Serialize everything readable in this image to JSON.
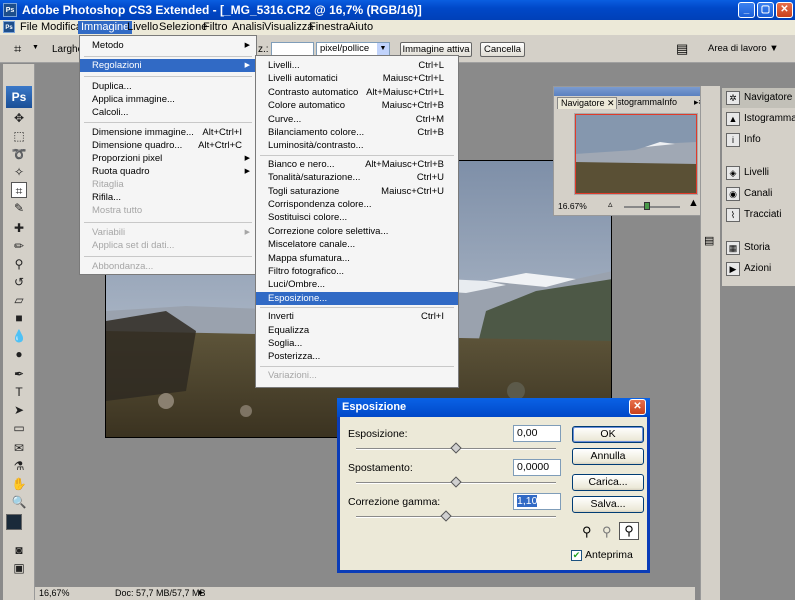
{
  "window": {
    "title": "Adobe Photoshop CS3 Extended - [_MG_5316.CR2 @ 16,7% (RGB/16)]",
    "app_icon": "Ps"
  },
  "menubar": [
    "File",
    "Modifica",
    "Immagine",
    "Livello",
    "Selezione",
    "Filtro",
    "Analisi",
    "Visualizza",
    "Finestra",
    "Aiuto"
  ],
  "options": {
    "larghezza": "Larghez",
    "resolution_suffix": "z.:",
    "unit": "pixel/pollice",
    "active_image_btn": "Immagine attiva",
    "cancel_btn": "Cancella",
    "workspace": "Area di lavoro"
  },
  "image_menu": {
    "items": [
      {
        "label": "Metodo",
        "shortcut": "",
        "submenu": true,
        "disabled": false
      },
      {
        "label": "Regolazioni",
        "shortcut": "",
        "submenu": true,
        "disabled": false,
        "highlighted": true
      },
      {
        "label": "Duplica...",
        "shortcut": "",
        "disabled": false
      },
      {
        "label": "Applica immagine...",
        "shortcut": "",
        "disabled": false
      },
      {
        "label": "Calcoli...",
        "shortcut": "",
        "disabled": false
      },
      {
        "label": "Dimensione immagine...",
        "shortcut": "Alt+Ctrl+I",
        "disabled": false
      },
      {
        "label": "Dimensione quadro...",
        "shortcut": "Alt+Ctrl+C",
        "disabled": false
      },
      {
        "label": "Proporzioni pixel",
        "shortcut": "",
        "submenu": true,
        "disabled": false
      },
      {
        "label": "Ruota quadro",
        "shortcut": "",
        "submenu": true,
        "disabled": false
      },
      {
        "label": "Ritaglia",
        "shortcut": "",
        "disabled": true
      },
      {
        "label": "Rifila...",
        "shortcut": "",
        "disabled": false
      },
      {
        "label": "Mostra tutto",
        "shortcut": "",
        "disabled": true
      },
      {
        "label": "Variabili",
        "shortcut": "",
        "submenu": true,
        "disabled": true
      },
      {
        "label": "Applica set di dati...",
        "shortcut": "",
        "disabled": true
      },
      {
        "label": "Abbondanza...",
        "shortcut": "",
        "disabled": true
      }
    ]
  },
  "adjust_menu": {
    "items": [
      {
        "label": "Livelli...",
        "shortcut": "Ctrl+L"
      },
      {
        "label": "Livelli automatici",
        "shortcut": "Maiusc+Ctrl+L"
      },
      {
        "label": "Contrasto automatico",
        "shortcut": "Alt+Maiusc+Ctrl+L"
      },
      {
        "label": "Colore automatico",
        "shortcut": "Maiusc+Ctrl+B"
      },
      {
        "label": "Curve...",
        "shortcut": "Ctrl+M"
      },
      {
        "label": "Bilanciamento colore...",
        "shortcut": "Ctrl+B"
      },
      {
        "label": "Luminosità/contrasto...",
        "shortcut": ""
      },
      {
        "label": "Bianco e nero...",
        "shortcut": "Alt+Maiusc+Ctrl+B"
      },
      {
        "label": "Tonalità/saturazione...",
        "shortcut": "Ctrl+U"
      },
      {
        "label": "Togli saturazione",
        "shortcut": "Maiusc+Ctrl+U"
      },
      {
        "label": "Corrispondenza colore...",
        "shortcut": ""
      },
      {
        "label": "Sostituisci colore...",
        "shortcut": ""
      },
      {
        "label": "Correzione colore selettiva...",
        "shortcut": ""
      },
      {
        "label": "Miscelatore canale...",
        "shortcut": ""
      },
      {
        "label": "Mappa sfumatura...",
        "shortcut": ""
      },
      {
        "label": "Filtro fotografico...",
        "shortcut": ""
      },
      {
        "label": "Luci/Ombre...",
        "shortcut": ""
      },
      {
        "label": "Esposizione...",
        "shortcut": "",
        "highlighted": true
      },
      {
        "label": "Inverti",
        "shortcut": "Ctrl+I"
      },
      {
        "label": "Equalizza",
        "shortcut": ""
      },
      {
        "label": "Soglia...",
        "shortcut": ""
      },
      {
        "label": "Posterizza...",
        "shortcut": ""
      },
      {
        "label": "Variazioni...",
        "shortcut": "",
        "disabled": true
      }
    ]
  },
  "navigator": {
    "tabs": [
      "Navigatore",
      "Istogramma",
      "Info"
    ],
    "zoom": "16.67%"
  },
  "dock": [
    "Navigatore",
    "Istogramma",
    "Info",
    "Livelli",
    "Canali",
    "Tracciati",
    "Storia",
    "Azioni"
  ],
  "dialog": {
    "title": "Esposizione",
    "exposure_label": "Esposizione:",
    "exposure_value": "0,00",
    "exposure_level": 0.5,
    "offset_label": "Spostamento:",
    "offset_value": "0,0000",
    "offset_level": 0.5,
    "gamma_label": "Correzione gamma:",
    "gamma_value": "1,10",
    "gamma_level": 0.45,
    "ok": "OK",
    "cancel": "Annulla",
    "load": "Carica...",
    "save": "Salva...",
    "preview_label": "Anteprima",
    "preview_checked": true
  },
  "status": {
    "zoom": "16,67%",
    "doc": "Doc: 57,7 MB/57,7 MB"
  },
  "colors": {
    "title_blue": "#0048c8",
    "menu_highlight": "#316ac5",
    "dialog_border": "#0a3cb8"
  }
}
